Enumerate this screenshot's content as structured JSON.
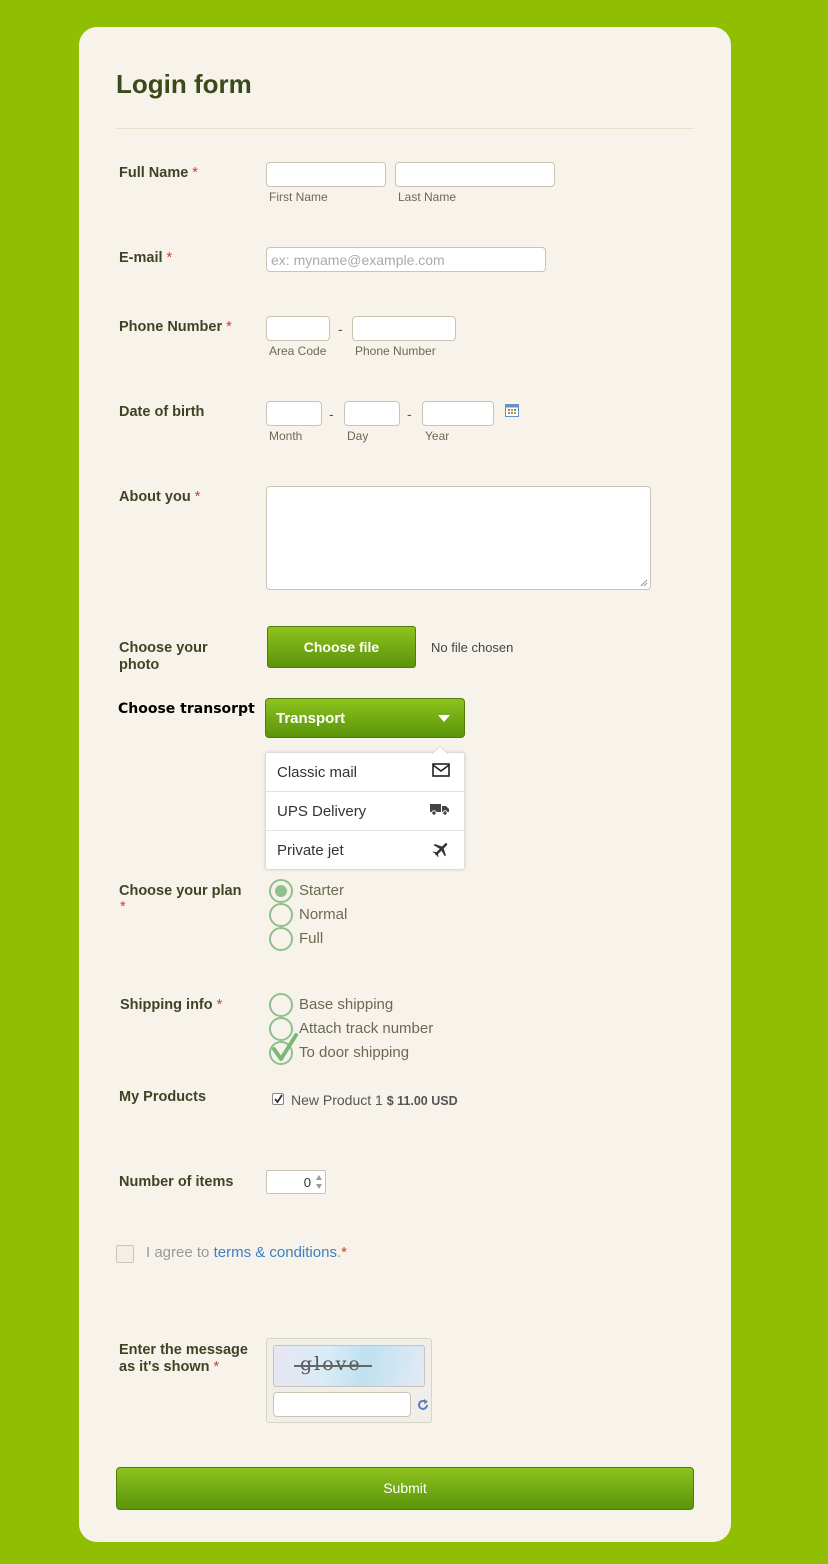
{
  "form": {
    "title": "Login form",
    "full_name": {
      "label": "Full Name",
      "required": "*",
      "first_caption": "First Name",
      "last_caption": "Last Name",
      "first_value": "",
      "last_value": ""
    },
    "email": {
      "label": "E-mail",
      "required": "*",
      "placeholder": "ex: myname@example.com",
      "value": ""
    },
    "phone": {
      "label": "Phone Number",
      "required": "*",
      "separator": "-",
      "area_caption": "Area Code",
      "number_caption": "Phone Number"
    },
    "dob": {
      "label": "Date of birth",
      "separator": "-",
      "month_caption": "Month",
      "day_caption": "Day",
      "year_caption": "Year",
      "calendar_icon": "calendar-icon"
    },
    "about": {
      "label": "About you",
      "required": "*",
      "value": ""
    },
    "photo": {
      "label": "Choose your photo",
      "button_label": "Choose file",
      "status": "No file chosen"
    },
    "transport": {
      "label": "Choose transorpt",
      "button_label": "Transport",
      "items": [
        {
          "label": "Classic mail",
          "icon": "envelope-icon"
        },
        {
          "label": "UPS Delivery",
          "icon": "truck-icon"
        },
        {
          "label": "Private jet",
          "icon": "plane-icon"
        }
      ]
    },
    "plan": {
      "label": "Choose your plan",
      "required": "*",
      "options": [
        {
          "label": "Starter",
          "selected": true
        },
        {
          "label": "Normal",
          "selected": false
        },
        {
          "label": "Full",
          "selected": false
        }
      ]
    },
    "shipping": {
      "label": "Shipping info",
      "required": "*",
      "options": [
        {
          "label": "Base shipping",
          "checked": false
        },
        {
          "label": "Attach track number",
          "checked": false
        },
        {
          "label": "To door shipping",
          "checked": true
        }
      ]
    },
    "products": {
      "label": "My Products",
      "item_name": "New Product 1",
      "item_price": "$ 11.00 USD",
      "checked": true
    },
    "items_count": {
      "label": "Number of items",
      "value": "0"
    },
    "terms": {
      "prefix": "I agree to",
      "link": "terms & conditions",
      "suffix": ".",
      "required": "*"
    },
    "captcha": {
      "label_line1": "Enter the message",
      "label_line2": "as it's shown",
      "required": "*",
      "word": "glove",
      "refresh_icon": "refresh-icon"
    },
    "submit_label": "Submit"
  },
  "colors": {
    "background": "#8fbf00",
    "card": "#f8f3ea",
    "button": "#6ea80f",
    "required": "#d23a2a",
    "link": "#3b7fc4",
    "radio": "#8fc08f"
  }
}
